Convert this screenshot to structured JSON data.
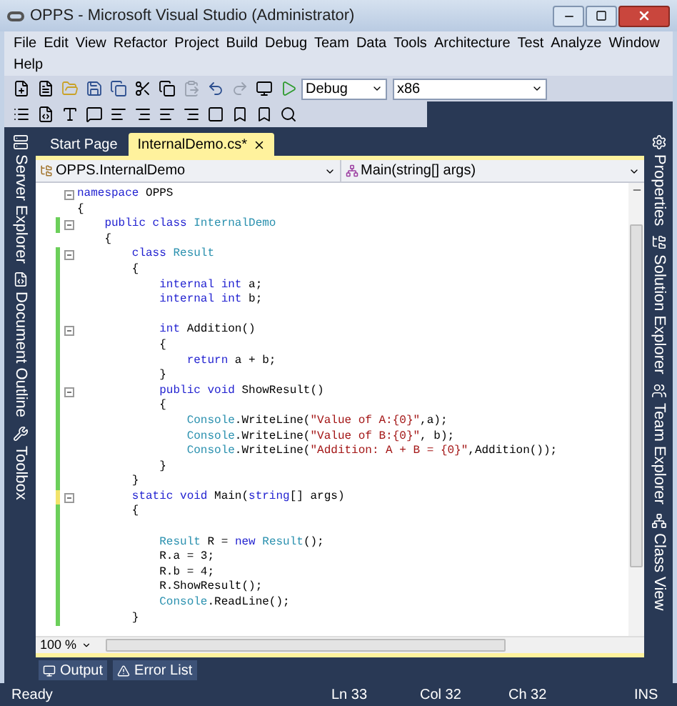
{
  "window": {
    "title": "OPPS - Microsoft Visual Studio (Administrator)"
  },
  "menu": [
    {
      "label": "File"
    },
    {
      "label": "Edit"
    },
    {
      "label": "View"
    },
    {
      "label": "Refactor"
    },
    {
      "label": "Project"
    },
    {
      "label": "Build"
    },
    {
      "label": "Debug"
    },
    {
      "label": "Team"
    },
    {
      "label": "Data"
    },
    {
      "label": "Tools"
    },
    {
      "label": "Architecture"
    },
    {
      "label": "Test"
    },
    {
      "label": "Analyze"
    },
    {
      "label": "Window"
    },
    {
      "label": "Help"
    }
  ],
  "toolbar": {
    "configuration": "Debug",
    "platform": "x86"
  },
  "left_panels": [
    "Server Explorer",
    "Document Outline",
    "Toolbox"
  ],
  "right_panels": [
    "Properties",
    "Solution Explorer",
    "Team Explorer",
    "Class View"
  ],
  "tabs": [
    {
      "label": "Start Page",
      "selected": false
    },
    {
      "label": "InternalDemo.cs*",
      "selected": true
    }
  ],
  "navigation": {
    "type": "OPPS.InternalDemo",
    "member": "Main(string[] args)"
  },
  "code": [
    {
      "fold": true,
      "tokens": [
        {
          "kind": "keyword",
          "text": "namespace"
        },
        {
          "kind": "plain",
          "text": " OPPS"
        }
      ]
    },
    {
      "fold": false,
      "tokens": [
        {
          "kind": "plain",
          "text": "{"
        }
      ]
    },
    {
      "color": "#6ccf5a",
      "fold": true,
      "tokens": [
        {
          "kind": "keyword",
          "text": "    public class"
        },
        {
          "kind": "type",
          "text": " InternalDemo"
        }
      ]
    },
    {
      "fold": false,
      "tokens": [
        {
          "kind": "plain",
          "text": "    {"
        }
      ]
    },
    {
      "color": "#6ccf5a",
      "fold": true,
      "tokens": [
        {
          "kind": "keyword",
          "text": "        class"
        },
        {
          "kind": "type",
          "text": " Result"
        }
      ]
    },
    {
      "color": "#6ccf5a",
      "fold": false,
      "tokens": [
        {
          "kind": "plain",
          "text": "        {"
        }
      ]
    },
    {
      "color": "#6ccf5a",
      "fold": false,
      "tokens": [
        {
          "kind": "keyword",
          "text": "            internal int"
        },
        {
          "kind": "plain",
          "text": " a;"
        }
      ]
    },
    {
      "color": "#6ccf5a",
      "fold": false,
      "tokens": [
        {
          "kind": "keyword",
          "text": "            internal int"
        },
        {
          "kind": "plain",
          "text": " b;"
        }
      ]
    },
    {
      "color": "#6ccf5a"
    },
    {
      "color": "#6ccf5a",
      "fold": true,
      "tokens": [
        {
          "kind": "keyword",
          "text": "            int"
        },
        {
          "kind": "plain",
          "text": " Addition()"
        }
      ]
    },
    {
      "color": "#6ccf5a",
      "fold": false,
      "tokens": [
        {
          "kind": "plain",
          "text": "            {"
        }
      ]
    },
    {
      "color": "#6ccf5a",
      "fold": false,
      "tokens": [
        {
          "kind": "keyword",
          "text": "                return"
        },
        {
          "kind": "plain",
          "text": " a + b;"
        }
      ]
    },
    {
      "color": "#6ccf5a",
      "fold": false,
      "tokens": [
        {
          "kind": "plain",
          "text": "            }"
        }
      ]
    },
    {
      "color": "#6ccf5a",
      "fold": true,
      "tokens": [
        {
          "kind": "keyword",
          "text": "            public void"
        },
        {
          "kind": "plain",
          "text": " ShowResult()"
        }
      ]
    },
    {
      "color": "#6ccf5a",
      "fold": false,
      "tokens": [
        {
          "kind": "plain",
          "text": "            {"
        }
      ]
    },
    {
      "color": "#6ccf5a",
      "fold": false,
      "tokens": [
        {
          "kind": "type",
          "text": "                Console"
        },
        {
          "kind": "plain",
          "text": ".WriteLine("
        },
        {
          "kind": "string",
          "text": "\"Value of A:{0}\""
        },
        {
          "kind": "plain",
          "text": ",a);"
        }
      ]
    },
    {
      "color": "#6ccf5a",
      "fold": false,
      "tokens": [
        {
          "kind": "type",
          "text": "                Console"
        },
        {
          "kind": "plain",
          "text": ".WriteLine("
        },
        {
          "kind": "string",
          "text": "\"Value of B:{0}\""
        },
        {
          "kind": "plain",
          "text": ", b);"
        }
      ]
    },
    {
      "color": "#6ccf5a",
      "fold": false,
      "tokens": [
        {
          "kind": "type",
          "text": "                Console"
        },
        {
          "kind": "plain",
          "text": ".WriteLine("
        },
        {
          "kind": "string",
          "text": "\"Addition: A + B = {0}\""
        },
        {
          "kind": "plain",
          "text": ",Addition());"
        }
      ]
    },
    {
      "color": "#6ccf5a",
      "fold": false,
      "tokens": [
        {
          "kind": "plain",
          "text": "            }"
        }
      ]
    },
    {
      "color": "#6ccf5a",
      "fold": false,
      "tokens": [
        {
          "kind": "plain",
          "text": "        }"
        }
      ]
    },
    {
      "color": "#f2e36b",
      "fold": true,
      "tokens": [
        {
          "kind": "keyword",
          "text": "        static void"
        },
        {
          "kind": "plain",
          "text": " Main("
        },
        {
          "kind": "keyword",
          "text": "string"
        },
        {
          "kind": "plain",
          "text": "[] args)"
        }
      ]
    },
    {
      "color": "#6ccf5a",
      "fold": false,
      "tokens": [
        {
          "kind": "plain",
          "text": "        {"
        }
      ]
    },
    {
      "color": "#6ccf5a"
    },
    {
      "color": "#6ccf5a",
      "fold": false,
      "tokens": [
        {
          "kind": "type",
          "text": "            Result"
        },
        {
          "kind": "plain",
          "text": " R = "
        },
        {
          "kind": "keyword",
          "text": "new"
        },
        {
          "kind": "type",
          "text": " Result"
        },
        {
          "kind": "plain",
          "text": "();"
        }
      ]
    },
    {
      "color": "#6ccf5a",
      "fold": false,
      "tokens": [
        {
          "kind": "plain",
          "text": "            R.a = 3;"
        }
      ]
    },
    {
      "color": "#6ccf5a",
      "fold": false,
      "tokens": [
        {
          "kind": "plain",
          "text": "            R.b = 4;"
        }
      ]
    },
    {
      "color": "#6ccf5a",
      "fold": false,
      "tokens": [
        {
          "kind": "plain",
          "text": "            R.ShowResult();"
        }
      ]
    },
    {
      "color": "#6ccf5a",
      "fold": false,
      "tokens": [
        {
          "kind": "type",
          "text": "            Console"
        },
        {
          "kind": "plain",
          "text": ".ReadLine();"
        }
      ]
    },
    {
      "color": "#6ccf5a",
      "fold": false,
      "tokens": [
        {
          "kind": "plain",
          "text": "        }"
        }
      ]
    }
  ],
  "zoom": "100 %",
  "bottom_tabs": [
    "Output",
    "Error List"
  ],
  "status_bar": {
    "message": "Ready",
    "line": "Ln 33",
    "column": "Col 32",
    "char": "Ch 32",
    "mode": "INS"
  }
}
